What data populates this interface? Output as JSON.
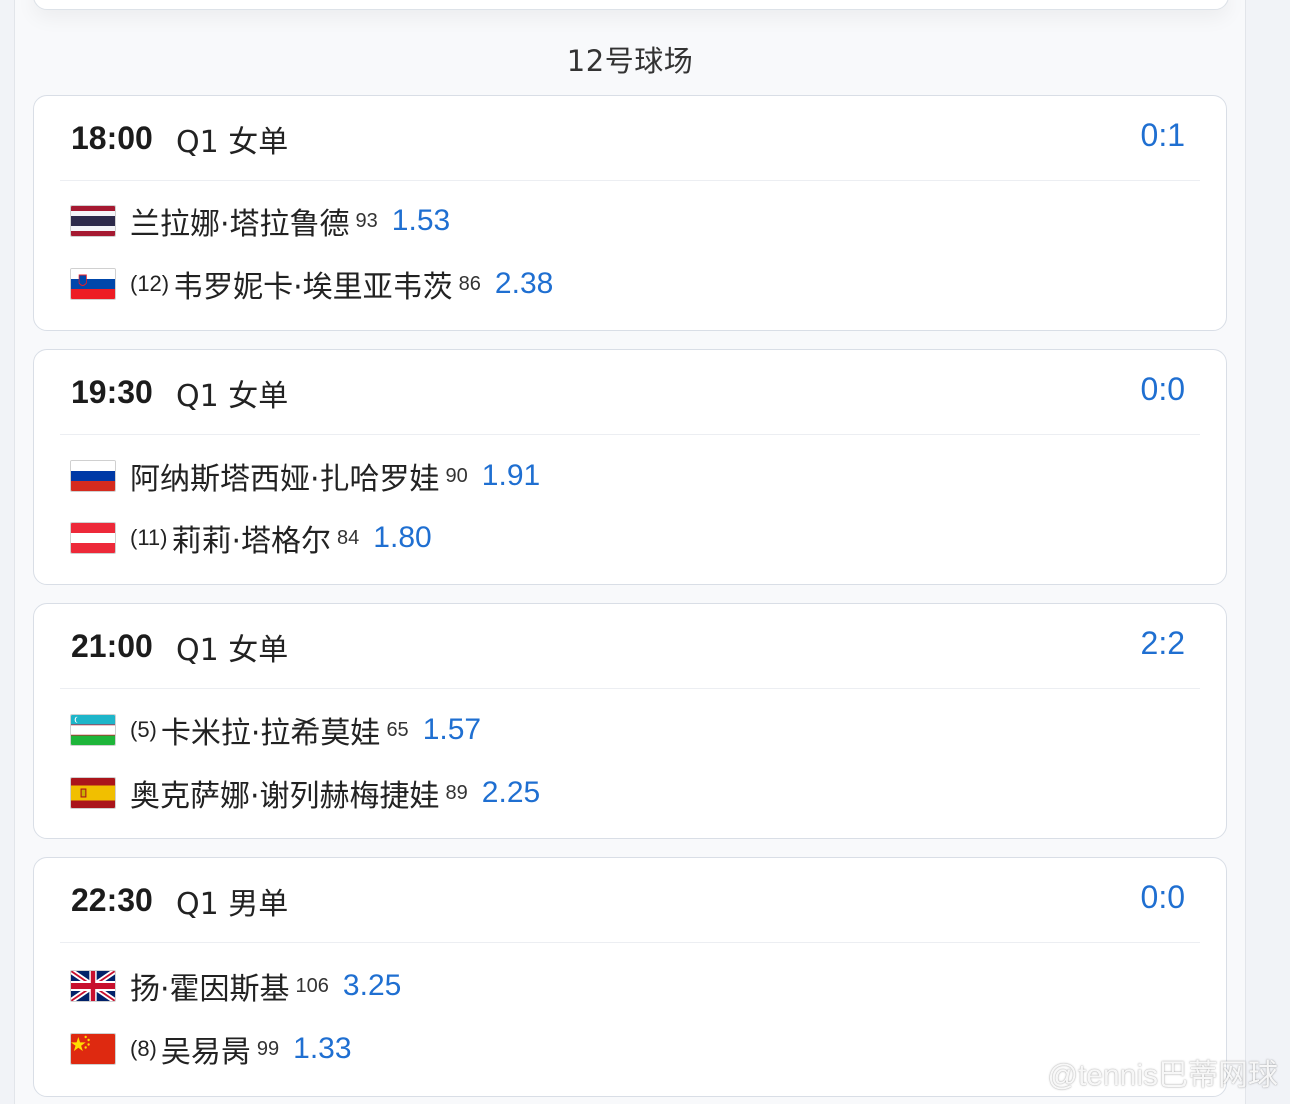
{
  "court": {
    "title": "12号球场"
  },
  "matches": [
    {
      "time": "18:00",
      "round": "Q1 女单",
      "score": "0:1",
      "players": [
        {
          "flag": "thailand-flag-icon",
          "seed": "",
          "name": "兰拉娜·塔拉鲁德",
          "rank": "93",
          "odds": "1.53"
        },
        {
          "flag": "slovenia-flag-icon",
          "seed": "(12)",
          "name": "韦罗妮卡·埃里亚韦茨",
          "rank": "86",
          "odds": "2.38"
        }
      ]
    },
    {
      "time": "19:30",
      "round": "Q1 女单",
      "score": "0:0",
      "players": [
        {
          "flag": "russia-flag-icon",
          "seed": "",
          "name": "阿纳斯塔西娅·扎哈罗娃",
          "rank": "90",
          "odds": "1.91"
        },
        {
          "flag": "austria-flag-icon",
          "seed": "(11)",
          "name": "莉莉·塔格尔",
          "rank": "84",
          "odds": "1.80"
        }
      ]
    },
    {
      "time": "21:00",
      "round": "Q1 女单",
      "score": "2:2",
      "players": [
        {
          "flag": "uzbekistan-flag-icon",
          "seed": "(5)",
          "name": "卡米拉·拉希莫娃",
          "rank": "65",
          "odds": "1.57"
        },
        {
          "flag": "spain-flag-icon",
          "seed": "",
          "name": "奥克萨娜·谢列赫梅捷娃",
          "rank": "89",
          "odds": "2.25"
        }
      ]
    },
    {
      "time": "22:30",
      "round": "Q1 男单",
      "score": "0:0",
      "players": [
        {
          "flag": "uk-flag-icon",
          "seed": "",
          "name": "扬·霍因斯基",
          "rank": "106",
          "odds": "3.25"
        },
        {
          "flag": "china-flag-icon",
          "seed": "(8)",
          "name": "吴易昺",
          "rank": "99",
          "odds": "1.33"
        }
      ]
    }
  ],
  "watermark": {
    "text": "@tennis巴蒂网球",
    "icon": "weibo-logo-icon"
  }
}
